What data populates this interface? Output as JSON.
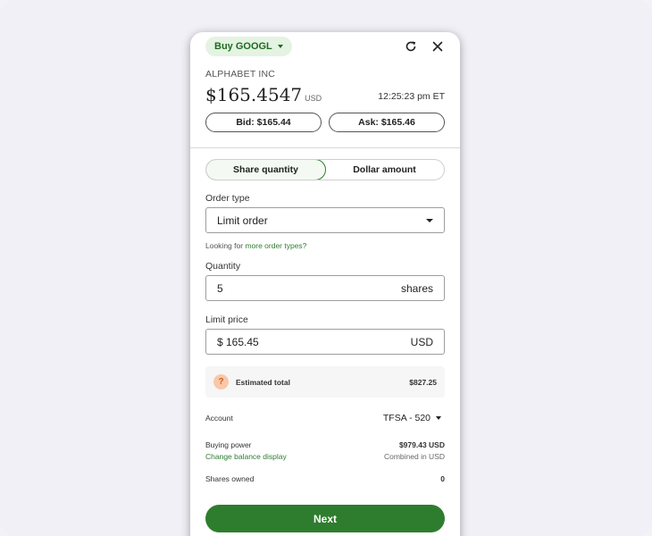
{
  "header": {
    "chip_label": "Buy GOOGL",
    "refresh_icon": "refresh-icon",
    "close_icon": "close-icon"
  },
  "quote": {
    "company": "ALPHABET INC",
    "price": "$165.4547",
    "currency": "USD",
    "time": "12:25:23 pm ET",
    "bid_label": "Bid: $165.44",
    "ask_label": "Ask: $165.46"
  },
  "mode": {
    "options": [
      "Share quantity",
      "Dollar amount"
    ],
    "selected": "Share quantity"
  },
  "order_type": {
    "label": "Order type",
    "value": "Limit order",
    "note_prefix": "Looking for",
    "note_link": "more order types?"
  },
  "quantity": {
    "label": "Quantity",
    "value": "5",
    "unit": "shares"
  },
  "limit_price": {
    "label": "Limit price",
    "value": "$ 165.45",
    "unit": "USD"
  },
  "estimate": {
    "label": "Estimated total",
    "value": "$827.25"
  },
  "account": {
    "label": "Account",
    "value": "TFSA - 520"
  },
  "buying_power": {
    "label": "Buying power",
    "value": "$979.43 USD",
    "link": "Change balance display",
    "note": "Combined in USD"
  },
  "shares_owned": {
    "label": "Shares owned",
    "value": "0"
  },
  "actions": {
    "next_label": "Next"
  },
  "colors": {
    "accent": "#2e7d32",
    "chip_bg": "#e4f3e2",
    "background": "#f0f0f6"
  }
}
